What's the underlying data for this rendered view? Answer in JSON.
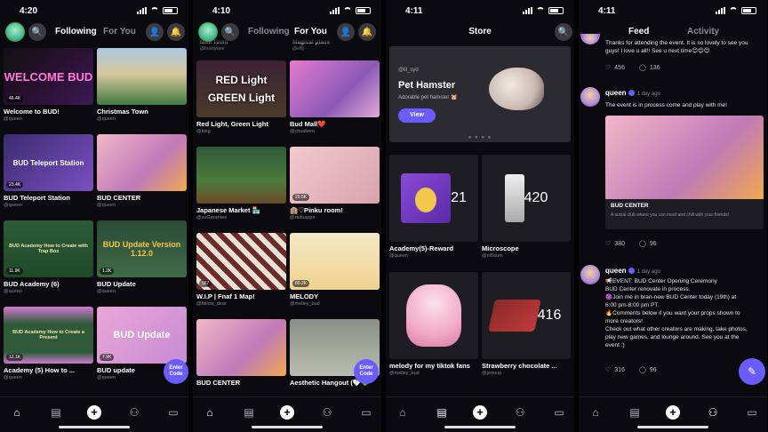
{
  "screen1": {
    "time": "4:20",
    "tabs": [
      "Following",
      "For You"
    ],
    "cards": [
      {
        "title": "Welcome to BUD!",
        "author": "@queen",
        "thumb_text": "WELCOME BUD",
        "plays": "46.4K"
      },
      {
        "title": "Christmas Town",
        "author": "@queen",
        "thumb_text": "",
        "plays": ""
      },
      {
        "title": "BUD Teleport Station",
        "author": "@queen",
        "thumb_text": "BUD Teleport Station",
        "plays": "23.4K"
      },
      {
        "title": "BUD CENTER",
        "author": "@queen",
        "thumb_text": "",
        "plays": ""
      },
      {
        "title": "BUD Academy (6)",
        "author": "@queen",
        "thumb_text": "BUD Academy How to Create with Trap Box",
        "plays": "11.9K"
      },
      {
        "title": "BUD Update",
        "author": "@queen",
        "thumb_text": "BUD Update Version 1.12.0",
        "plays": "1.2K"
      },
      {
        "title": "Academy (5) How to ...",
        "author": "@queen",
        "thumb_text": "BUD Academy How to Create a Present",
        "plays": "12.1K"
      },
      {
        "title": "BUD update",
        "author": "@queen",
        "thumb_text": "BUD Update",
        "plays": "7.9K"
      }
    ],
    "enter_label": "Enter Code"
  },
  "screen2": {
    "time": "4:10",
    "tabs": [
      "Following",
      "For You"
    ],
    "top_partial": [
      "Mini Town",
      "Magical place"
    ],
    "top_partial_authors": [
      "@bushywee",
      "@elfij"
    ],
    "cards": [
      {
        "title": "Red Light, Green Light",
        "author": "@king",
        "thumb_text": "RED Light GREEN Light",
        "plays": ""
      },
      {
        "title": "Bud Mall❤️",
        "author": "@cloudeen",
        "thumb_text": "",
        "plays": ""
      },
      {
        "title": "Japanese Market 🏪",
        "author": "@suGarantes",
        "thumb_text": "",
        "plays": ""
      },
      {
        "title": "🏨♡Pinku room!",
        "author": "@raifuapps",
        "thumb_text": "",
        "plays": "20.5K"
      },
      {
        "title": "W.I.P | Fnaf 1 Map!",
        "author": "@follow_dear",
        "thumb_text": "",
        "plays": "967"
      },
      {
        "title": "MELODY",
        "author": "@melley_bud",
        "thumb_text": "",
        "plays": "80.2K"
      },
      {
        "title": "BUD CENTER",
        "author": "",
        "thumb_text": "",
        "plays": ""
      },
      {
        "title": "Aesthetic Hangout (🤍💚",
        "author": "",
        "thumb_text": "",
        "plays": ""
      }
    ],
    "enter_label": "Enter Code"
  },
  "screen3": {
    "time": "4:11",
    "title": "Store",
    "hero": {
      "handle": "@lil_syd",
      "title": "Pet Hamster",
      "subtitle": "Adorable pet hamster 🐹",
      "button": "View"
    },
    "dots": "● ● ● ●",
    "items": [
      {
        "title": "Academy(5)-Reward",
        "author": "@queen",
        "stat": "21"
      },
      {
        "title": "Microscope",
        "author": "@rrBaum",
        "stat": "420"
      },
      {
        "title": "melody for my tiktok fans",
        "author": "@melley_bud",
        "stat": ""
      },
      {
        "title": "Strawberry chocolate ...",
        "author": "@jennuu",
        "stat": "416"
      }
    ]
  },
  "screen4": {
    "time": "4:11",
    "tabs": [
      "Feed",
      "Activity"
    ],
    "top_text": "Thanks for attending the event. It is so lovely to see you guys! I love u all!! See u next time😊😊😊",
    "top_likes": "456",
    "top_comments": "136",
    "post1": {
      "name": "queen",
      "ago": "1 day ago",
      "text": "The event is in process come and play with me!",
      "embed_title": "BUD CENTER",
      "embed_text": "A social club where you can meet and chill with your friends!",
      "likes": "380",
      "comments": "96"
    },
    "post2": {
      "name": "queen",
      "ago": "1 day ago",
      "lines": [
        "📢EVENT: BUD Center Opening Ceremony",
        "BUD Center renovate in process.",
        "🟣Join me in bran-new BUD Center today (19th) at 6:00 pm-8:00 pm PT.",
        "🔥Comments below if you want your props shown to more creators!",
        "Check out what other creators are making, take photos, play new games, and lounge around. See you at the event :)"
      ],
      "likes": "316",
      "comments": "96"
    }
  },
  "colors": {
    "accent": "#6b5cff",
    "bg": "#0b0b0f",
    "card": "#1d1d22"
  },
  "icons": [
    "search-icon",
    "user-icon",
    "bell-icon",
    "home-icon",
    "store-icon",
    "plus-icon",
    "people-icon",
    "chat-icon",
    "heart-icon",
    "comment-icon",
    "edit-icon"
  ]
}
